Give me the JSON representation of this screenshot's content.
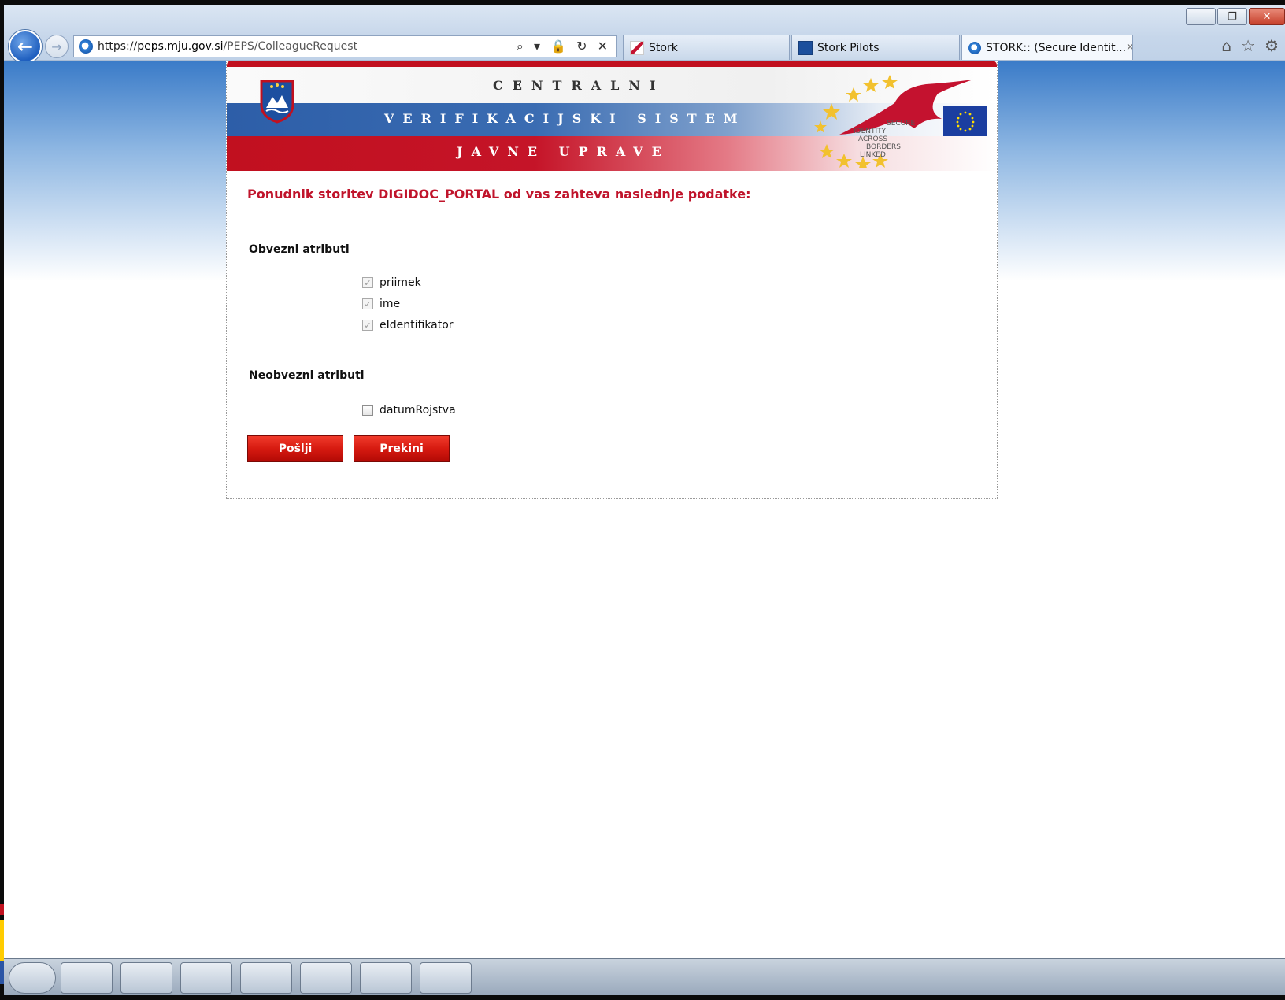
{
  "browser": {
    "address": {
      "scheme": "https://",
      "host": "peps.mju.gov.si",
      "path": "/PEPS/ColleagueRequest",
      "tools": "⌕ ▾ 🔒 ↻ ✕"
    },
    "tabs": [
      {
        "label": "Stork",
        "icon": "stork-icon"
      },
      {
        "label": "Stork Pilots",
        "icon": "pilots-icon"
      },
      {
        "label": "STORK:: (Secure Identit...",
        "icon": "ie-icon",
        "close": "✕"
      }
    ],
    "right_icons": [
      "home-icon",
      "favorites-icon",
      "settings-icon"
    ],
    "window_controls": {
      "minimize": "–",
      "restore": "❐",
      "close": "✕"
    }
  },
  "banner": {
    "line1": "CENTRALNI",
    "line2": "VERIFIKACIJSKI SISTEM",
    "line3": "JAVNE UPRAVE",
    "logo_text": [
      "SECURE",
      "IDENTITY",
      "ACROSS",
      "BORDERS",
      "LINKED"
    ]
  },
  "page": {
    "headline": "Ponudnik storitev DIGIDOC_PORTAL od vas zahteva naslednje podatke:",
    "mandatory_title": "Obvezni atributi",
    "mandatory": [
      {
        "label": "priimek",
        "checked": true
      },
      {
        "label": "ime",
        "checked": true
      },
      {
        "label": "eIdentifikator",
        "checked": true
      }
    ],
    "optional_title": "Neobvezni atributi",
    "optional": [
      {
        "label": "datumRojstva",
        "checked": false
      }
    ],
    "send_button": "Pošlji",
    "cancel_button": "Prekini"
  },
  "colors": {
    "accent_red": "#c0142b",
    "button_red": "#d61a10",
    "slovenian_blue": "#2d5ea8"
  }
}
